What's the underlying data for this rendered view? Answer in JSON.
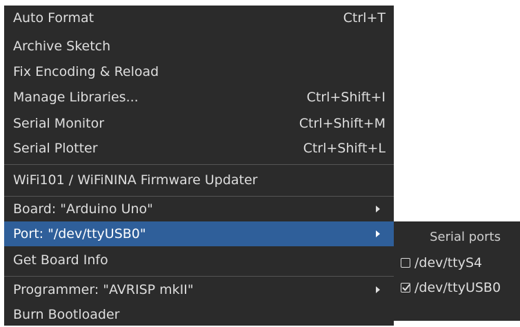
{
  "menu": {
    "items": [
      {
        "label": "Auto Format",
        "shortcut": "Ctrl+T"
      },
      {
        "label": "Archive Sketch",
        "shortcut": ""
      },
      {
        "label": "Fix Encoding & Reload",
        "shortcut": ""
      },
      {
        "label": "Manage Libraries...",
        "shortcut": "Ctrl+Shift+I"
      },
      {
        "label": "Serial Monitor",
        "shortcut": "Ctrl+Shift+M"
      },
      {
        "label": "Serial Plotter",
        "shortcut": "Ctrl+Shift+L"
      },
      {
        "label": "WiFi101 / WiFiNINA Firmware Updater",
        "shortcut": ""
      },
      {
        "label": "Board: \"Arduino Uno\"",
        "shortcut": ""
      },
      {
        "label": "Port: \"/dev/ttyUSB0\"",
        "shortcut": ""
      },
      {
        "label": "Get Board Info",
        "shortcut": ""
      },
      {
        "label": "Programmer: \"AVRISP mkII\"",
        "shortcut": ""
      },
      {
        "label": "Burn Bootloader",
        "shortcut": ""
      }
    ]
  },
  "submenu": {
    "header": "Serial ports",
    "ports": [
      {
        "label": "/dev/ttyS4",
        "checked": false
      },
      {
        "label": "/dev/ttyUSB0",
        "checked": true
      }
    ]
  },
  "colors": {
    "menu_bg": "#2b2b2b",
    "highlight": "#2f5f9a",
    "text": "#dedede"
  }
}
